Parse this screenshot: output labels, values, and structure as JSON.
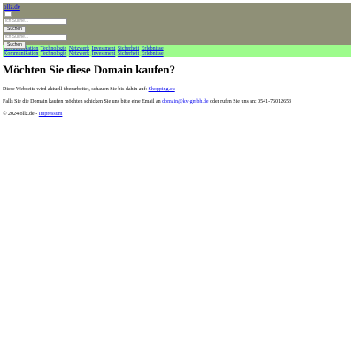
{
  "header": {
    "site_link": "ollz.de",
    "search_top": {
      "placeholder": "ich Suche...",
      "button": "Suchen"
    },
    "search_bottom": {
      "placeholder": "ich Suche...",
      "button": "Suchen"
    }
  },
  "nav": {
    "rows": [
      [
        "Kommunikation",
        "Technologie",
        "Netzwerk",
        "Investment",
        "Sicherheit",
        "Erlebnisse"
      ],
      [
        "Kommunikation",
        "Technologie",
        "Netzwerk",
        "Investment",
        "Sicherheit",
        "Erlebnisse"
      ]
    ]
  },
  "main": {
    "heading": "Möchten Sie diese Domain kaufen?",
    "para1_text": "Diese Webseite wird aktuell überarbeitet, schauen Sie bis dahin auf:",
    "para1_link": "Shopping.eu",
    "para2_text_before": "Falls Sie die Domain kaufen möchten schicken Sie uns bitte eine Email an",
    "para2_email": "domain@kv-gmbh.de",
    "para2_text_after": "oder rufen Sie uns an: 0541-76012653"
  },
  "footer": {
    "copyright": "© 2024 ollz.de -",
    "impressum": "Impressum"
  },
  "colors": {
    "header_bg": "#8f9077",
    "nav_bg": "#9dfc8c",
    "link": "#0000ee"
  }
}
